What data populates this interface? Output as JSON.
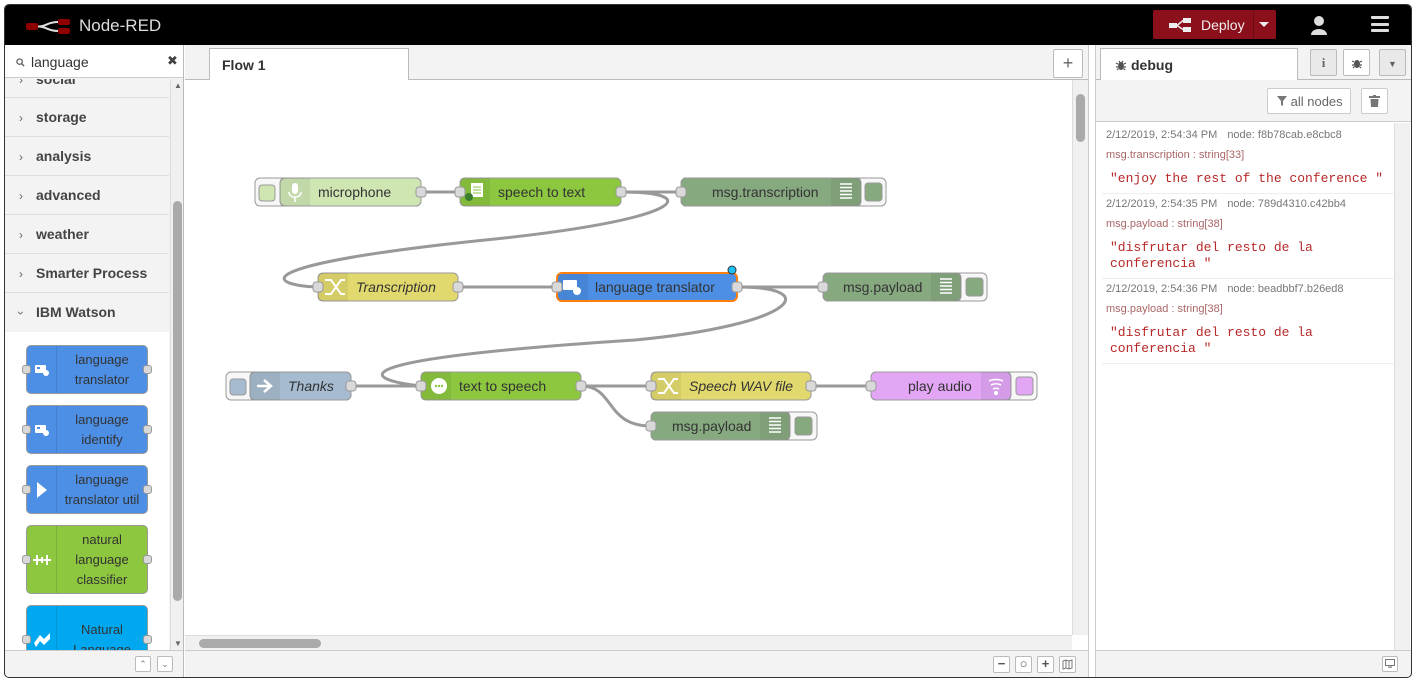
{
  "header": {
    "title": "Node-RED",
    "deploy_label": "Deploy"
  },
  "palette": {
    "search_value": "language",
    "clear_glyph": "✖",
    "categories": [
      "social",
      "storage",
      "analysis",
      "advanced",
      "weather",
      "Smarter Process",
      "IBM Watson"
    ],
    "watson_nodes": [
      {
        "label": "language translator",
        "icon": "translator-icon",
        "color": "#4c8fe5"
      },
      {
        "label": "language identify",
        "icon": "translator-icon",
        "color": "#4c8fe5"
      },
      {
        "label": "language translator util",
        "icon": "arrow-right-icon",
        "color": "#4c8fe5"
      },
      {
        "label": "natural language classifier",
        "icon": "classifier-icon",
        "color": "#8dc63f"
      },
      {
        "label": "Natural Language",
        "icon": "nlu-icon",
        "color": "#00a8f0"
      }
    ]
  },
  "workspace": {
    "tab_label": "Flow 1",
    "nodes": {
      "microphone": "microphone",
      "speech_to_text": "speech to text",
      "msg_transcription": "msg.transcription",
      "transcription": "Transcription",
      "language_translator": "language translator",
      "msg_payload_1": "msg.payload",
      "thanks": "Thanks",
      "text_to_speech": "text to speech",
      "speech_wav": "Speech WAV file",
      "play_audio": "play audio",
      "msg_payload_2": "msg.payload"
    }
  },
  "sidebar": {
    "tab_label": "debug",
    "filter_label": "all nodes",
    "messages": [
      {
        "time": "2/12/2019, 2:54:34 PM",
        "node": "node: f8b78cab.e8cbc8",
        "topic": "msg.transcription : string[33]",
        "value": "\"enjoy the rest of the conference \""
      },
      {
        "time": "2/12/2019, 2:54:35 PM",
        "node": "node: 789d4310.c42bb4",
        "topic": "msg.payload : string[38]",
        "value": "\"disfrutar del resto de la conferencia \""
      },
      {
        "time": "2/12/2019, 2:54:36 PM",
        "node": "node: beadbbf7.b26ed8",
        "topic": "msg.payload : string[38]",
        "value": "\"disfrutar del resto de la conferencia \""
      }
    ]
  },
  "colors": {
    "header_bg": "#000000",
    "deploy_bg": "#8c101c",
    "watson_blue": "#4c8fe5",
    "watson_green": "#8dc63f",
    "debug_green": "#87a980",
    "function_yellow": "#e2d96e",
    "inject_gray": "#a6bbcf",
    "audio_purple": "#e2a6f5",
    "selected_orange": "#ff7f0e",
    "debug_value_red": "#b72828"
  }
}
